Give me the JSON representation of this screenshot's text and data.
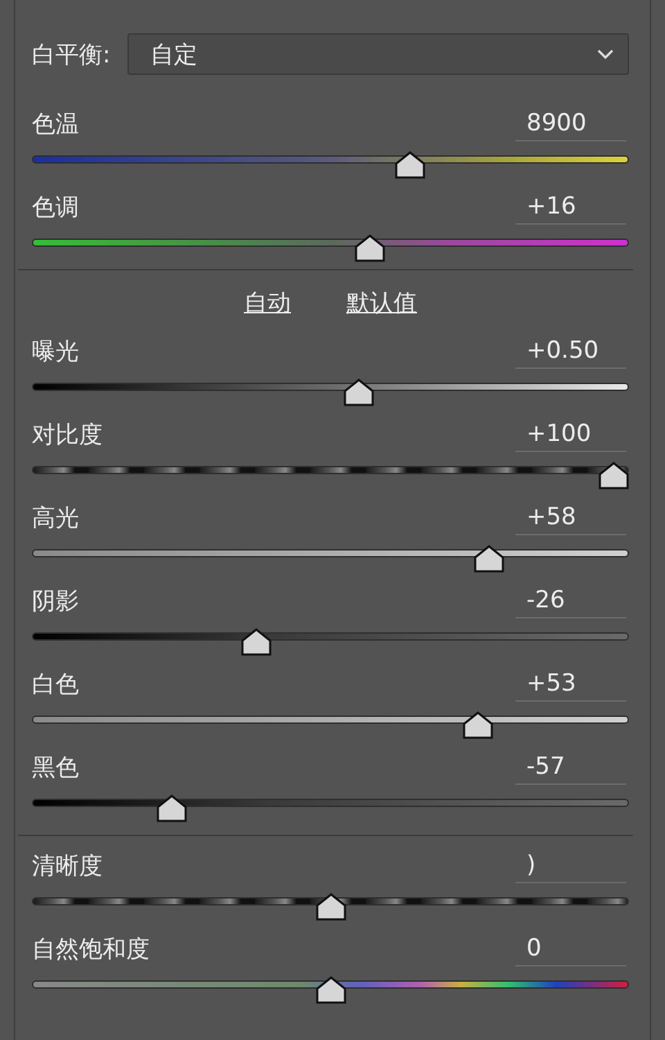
{
  "white_balance": {
    "label": "白平衡:",
    "value": "自定"
  },
  "sections": [
    {
      "sliders": [
        {
          "label": "色温",
          "value": "8900",
          "kind": "temperature",
          "level": 0.64
        },
        {
          "label": "色调",
          "value": "+16",
          "kind": "tint",
          "level": 0.57
        }
      ]
    },
    {
      "links": [
        {
          "label": "自动"
        },
        {
          "label": "默认值"
        }
      ],
      "sliders": [
        {
          "label": "曝光",
          "value": "+0.50",
          "kind": "dark-to-light",
          "level": 0.55
        },
        {
          "label": "对比度",
          "value": "+100",
          "kind": "stripes",
          "level": 1.0
        },
        {
          "label": "高光",
          "value": "+58",
          "kind": "light",
          "level": 0.78
        },
        {
          "label": "阴影",
          "value": "-26",
          "kind": "dark",
          "level": 0.37
        },
        {
          "label": "白色",
          "value": "+53",
          "kind": "light",
          "level": 0.76
        },
        {
          "label": "黑色",
          "value": "-57",
          "kind": "dark",
          "level": 0.22
        }
      ]
    },
    {
      "sliders": [
        {
          "label": "清晰度",
          "value": ")",
          "kind": "stripes",
          "level": 0.5
        },
        {
          "label": "自然饱和度",
          "value": "0",
          "kind": "vibrance",
          "level": 0.5
        }
      ]
    }
  ]
}
